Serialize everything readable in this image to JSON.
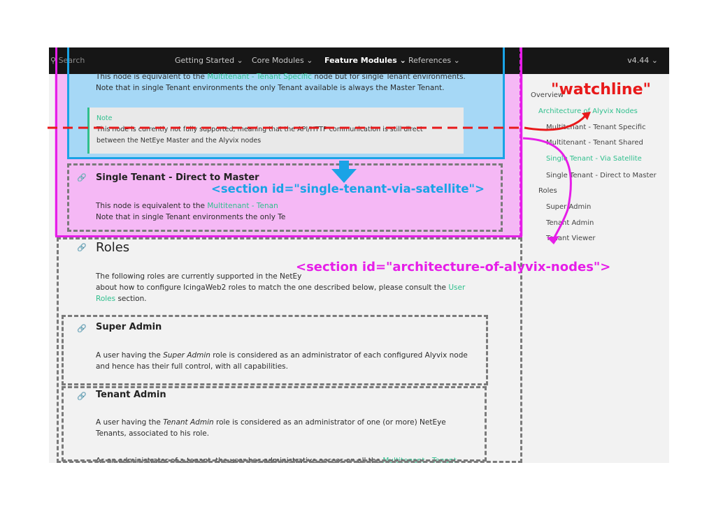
{
  "nav": {
    "search_placeholder": "Search",
    "items": [
      "Getting Started",
      "Core Modules",
      "Feature Modules",
      "References"
    ],
    "active_item": "Feature Modules",
    "version": "v4.44"
  },
  "content": {
    "intro_pre": "This node is equivalent to the ",
    "intro_link": "Multitenant - Tenant Specific",
    "intro_post": " node but for single Tenant environments.",
    "intro_line2": "Note that in single Tenant environments the only Tenant available is always the Master Tenant.",
    "note_title": "Note",
    "note_line1": "This node is currently not fully supported, meaning that the API/HTTP communication is still direct",
    "note_line2": "between the NetEye Master and the Alyvix nodes",
    "direct_heading": "Single Tenant - Direct to Master",
    "direct_pre": "This node is equivalent to the ",
    "direct_link": "Multitenant - Tenan",
    "direct_line2": "Note that in single Tenant environments the only Te",
    "roles_heading": "Roles",
    "roles_line1": "The following roles are currently supported in the NetEy",
    "roles_line2": "about how to configure IcingaWeb2 roles to match the one described below, please consult the ",
    "roles_link1": "User",
    "roles_link2": "Roles",
    "roles_line3": " section.",
    "super_heading": "Super Admin",
    "super_pre": "A user having the ",
    "super_em": "Super Admin",
    "super_post": " role is considered as an administrator of each configured Alyvix node",
    "super_line2": "and hence has their full control, with all capabilities.",
    "tenant_heading": "Tenant Admin",
    "tenant_pre": "A user having the ",
    "tenant_em": "Tenant Admin",
    "tenant_post": " role is considered as an administrator of one (or more) NetEye",
    "tenant_line2": "Tenants, associated to his role.",
    "tenant_line3_pre": "As an administrator of a tenant, the user has administrative access on all the ",
    "tenant_line3_link": "Multitenant - Tenant"
  },
  "toc": {
    "overview": "Overview",
    "items": [
      {
        "label": "Architecture of Alyvix Nodes",
        "active": true
      },
      {
        "label": "Multitenant - Tenant Specific",
        "active": false
      },
      {
        "label": "Multitenant - Tenant Shared",
        "active": false
      },
      {
        "label": "Single Tenant - Via Satellite",
        "active": true
      },
      {
        "label": "Single Tenant - Direct to Master",
        "active": false
      },
      {
        "label": "Roles",
        "active": false
      },
      {
        "label": "Super Admin",
        "active": false
      },
      {
        "label": "Tenant Admin",
        "active": false
      },
      {
        "label": "Tenant Viewer",
        "active": false
      }
    ]
  },
  "annotations": {
    "watchline": "\"watchline\"",
    "section_satellite": "<section id=\"single-tenant-via-satellite\">",
    "section_architecture": "<section id=\"architecture-of-alyvix-nodes\">",
    "colors": {
      "watchline": "#e8191a",
      "magenta": "#e61ee8",
      "blue": "#1aa3e6",
      "blue_fill": "#a6d8f6",
      "pink_fill": "#f5b8f5",
      "grey_dash": "#7a7a7a"
    }
  }
}
